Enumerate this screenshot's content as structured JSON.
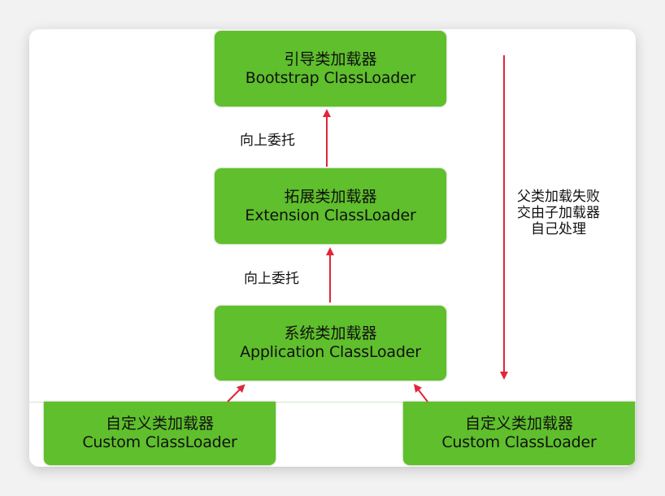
{
  "nodes": {
    "bootstrap": {
      "cn": "引导类加载器",
      "en": "Bootstrap ClassLoader"
    },
    "extension": {
      "cn": "拓展类加载器",
      "en": "Extension ClassLoader"
    },
    "application": {
      "cn": "系统类加载器",
      "en": "Application ClassLoader"
    },
    "custom_left": {
      "cn": "自定义类加载器",
      "en": "Custom ClassLoader"
    },
    "custom_right": {
      "cn": "自定义类加载器",
      "en": "Custom ClassLoader"
    }
  },
  "labels": {
    "delegate_up_1": "向上委托",
    "delegate_up_2": "向上委托",
    "fallback": [
      "父类加载失败",
      "交由子加载器",
      "自己处理"
    ]
  },
  "colors": {
    "box_fill": "#5fbf2c",
    "arrow": "#e0263a"
  }
}
